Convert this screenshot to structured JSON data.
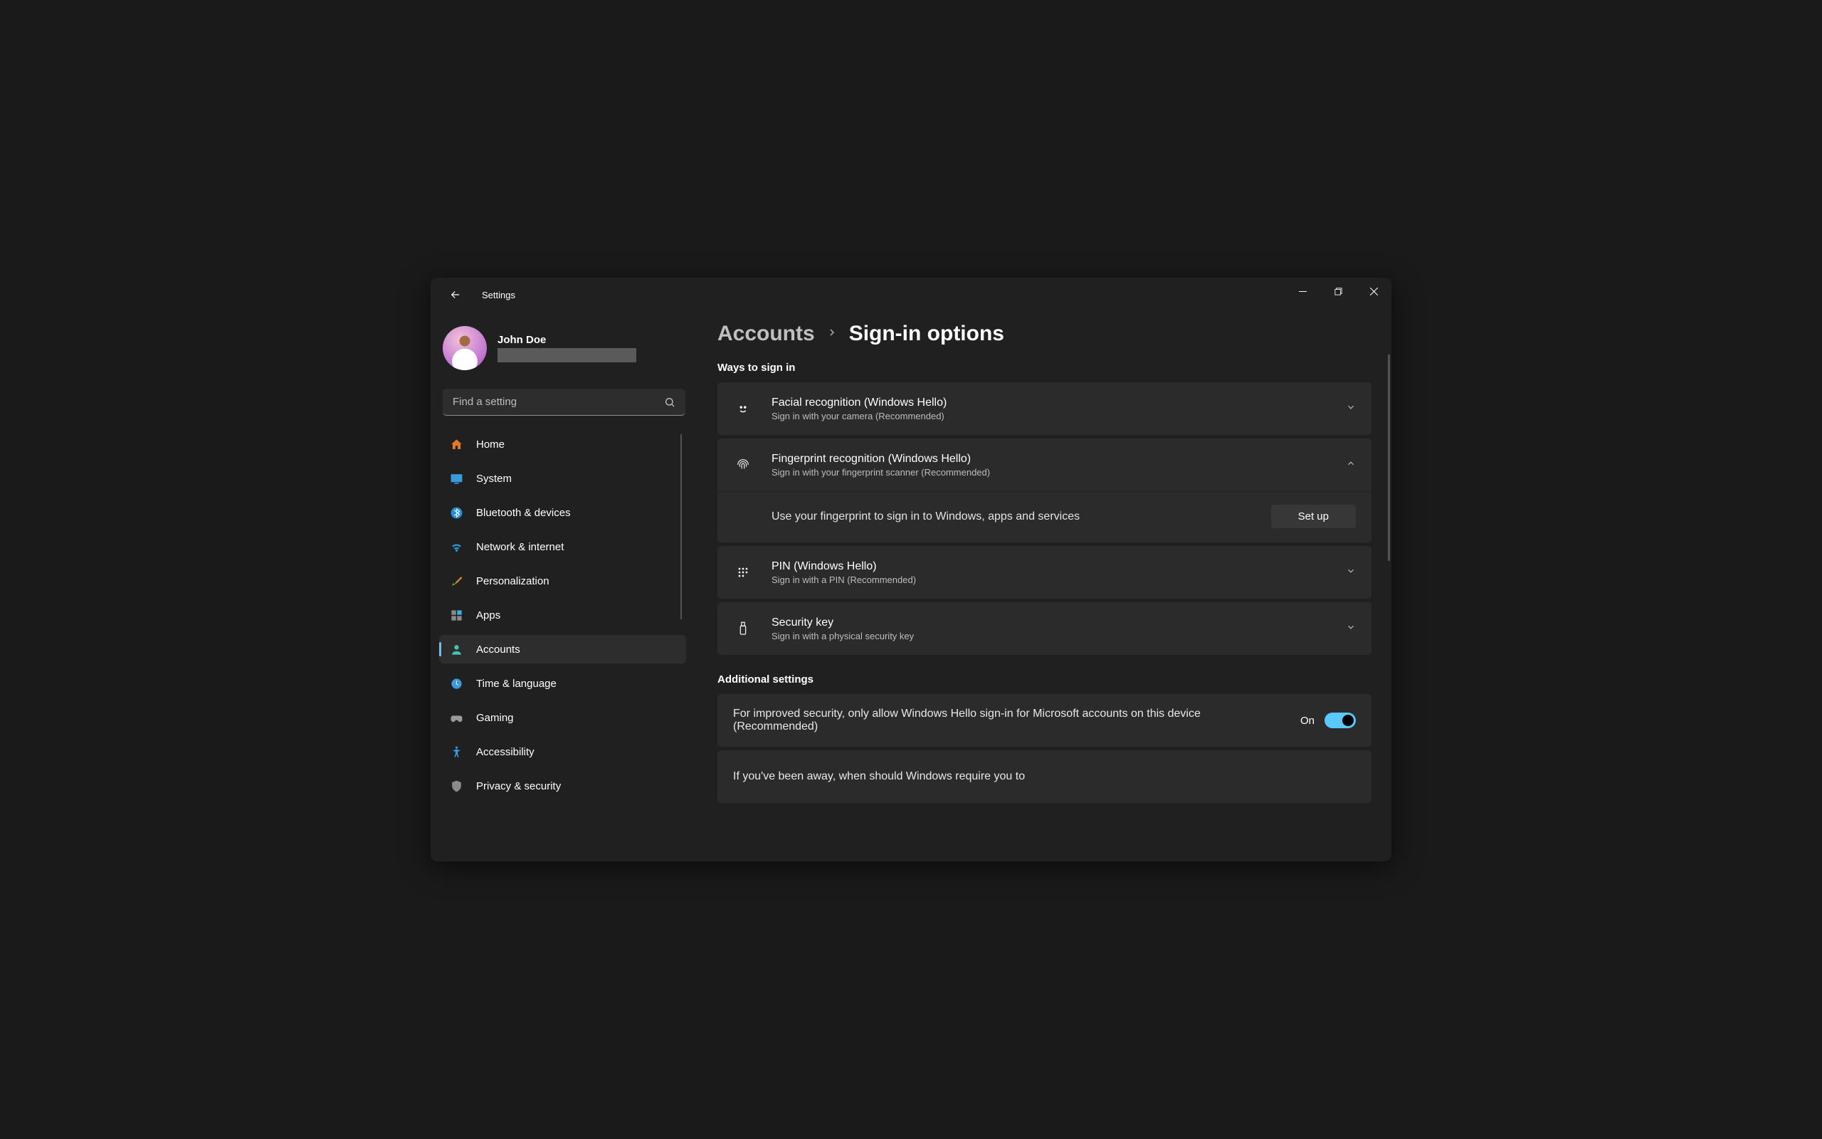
{
  "app_title": "Settings",
  "window_controls": {
    "minimize": "minimize",
    "maximize": "maximize",
    "close": "close"
  },
  "profile": {
    "name": "John Doe"
  },
  "search": {
    "placeholder": "Find a setting"
  },
  "sidebar": {
    "items": [
      {
        "label": "Home"
      },
      {
        "label": "System"
      },
      {
        "label": "Bluetooth & devices"
      },
      {
        "label": "Network & internet"
      },
      {
        "label": "Personalization"
      },
      {
        "label": "Apps"
      },
      {
        "label": "Accounts"
      },
      {
        "label": "Time & language"
      },
      {
        "label": "Gaming"
      },
      {
        "label": "Accessibility"
      },
      {
        "label": "Privacy & security"
      }
    ]
  },
  "breadcrumb": {
    "parent": "Accounts",
    "current": "Sign-in options"
  },
  "sections": {
    "ways_title": "Ways to sign in",
    "additional_title": "Additional settings"
  },
  "signin_options": {
    "face": {
      "title": "Facial recognition (Windows Hello)",
      "sub": "Sign in with your camera (Recommended)"
    },
    "finger": {
      "title": "Fingerprint recognition (Windows Hello)",
      "sub": "Sign in with your fingerprint scanner (Recommended)",
      "detail": "Use your fingerprint to sign in to Windows, apps and services",
      "setup_label": "Set up"
    },
    "pin": {
      "title": "PIN (Windows Hello)",
      "sub": "Sign in with a PIN (Recommended)"
    },
    "securitykey": {
      "title": "Security key",
      "sub": "Sign in with a physical security key"
    }
  },
  "additional": {
    "hello_only": {
      "text": "For improved security, only allow Windows Hello sign-in for Microsoft accounts on this device (Recommended)",
      "state_label": "On"
    },
    "away": {
      "text": "If you've been away, when should Windows require you to"
    }
  }
}
